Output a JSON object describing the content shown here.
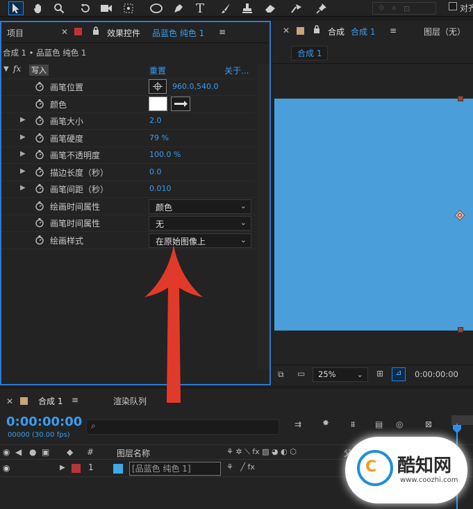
{
  "toolbar": {
    "tools": [
      "selection-tool",
      "hand-tool",
      "zoom-tool",
      "rotate-tool",
      "camera-tool",
      "pan-behind-tool",
      "shape-tool",
      "pen-tool",
      "type-tool",
      "brush-tool",
      "clone-stamp-tool",
      "eraser-tool",
      "roto-brush-tool",
      "puppet-pin-tool"
    ],
    "align_label": "对齐"
  },
  "project_tab": {
    "label": "项目"
  },
  "effect_panel": {
    "tab_prefix": "效果控件",
    "tab_layer": "品蓝色 纯色 1",
    "breadcrumb": "合成 1 • 品蓝色 纯色 1",
    "fx_label": "fx",
    "effect_name": "写入",
    "reset_label": "重置",
    "about_label": "关于...",
    "properties": [
      {
        "name": "画笔位置",
        "value": "960.0,540.0",
        "has_triangle": false,
        "kind": "position"
      },
      {
        "name": "颜色",
        "value": "",
        "has_triangle": false,
        "kind": "color"
      },
      {
        "name": "画笔大小",
        "value": "2.0",
        "has_triangle": true,
        "kind": "value"
      },
      {
        "name": "画笔硬度",
        "value": "79 %",
        "has_triangle": true,
        "kind": "value"
      },
      {
        "name": "画笔不透明度",
        "value": "100.0 %",
        "has_triangle": true,
        "kind": "value"
      },
      {
        "name": "描边长度（秒）",
        "value": "0.0",
        "has_triangle": true,
        "kind": "value"
      },
      {
        "name": "画笔间距（秒）",
        "value": "0.010",
        "has_triangle": true,
        "kind": "value"
      },
      {
        "name": "绘画时间属性",
        "value": "颜色",
        "has_triangle": false,
        "kind": "dropdown"
      },
      {
        "name": "画笔时间属性",
        "value": "无",
        "has_triangle": false,
        "kind": "dropdown"
      },
      {
        "name": "绘画样式",
        "value": "在原始图像上",
        "has_triangle": false,
        "kind": "dropdown"
      }
    ],
    "brush_color": "#ffffff"
  },
  "comp_panel": {
    "tab_prefix": "合成",
    "tab_name": "合成 1",
    "layer_tab": "图层（无）",
    "sub_tab": "合成 1",
    "zoom": "25%",
    "timecode": "0:00:00:00",
    "background_color": "#4a9fda"
  },
  "timeline": {
    "tab_name": "合成 1",
    "render_queue": "渲染队列",
    "timecode": "0:00:00:00",
    "frames": "00000 (30.00 fps)",
    "col_hash": "#",
    "col_layer_name": "图层名称",
    "col_parent": "父",
    "layer": {
      "index": "1",
      "name": "[品蓝色 纯色 1]",
      "label_color": "#b5363a",
      "swatch_color": "#3fa9e8"
    }
  },
  "watermark": {
    "brand": "酷知网",
    "url": "www.coozhi.com"
  },
  "colors": {
    "accent_blue": "#3b9cf0",
    "arrow_red": "#e23a2a"
  }
}
